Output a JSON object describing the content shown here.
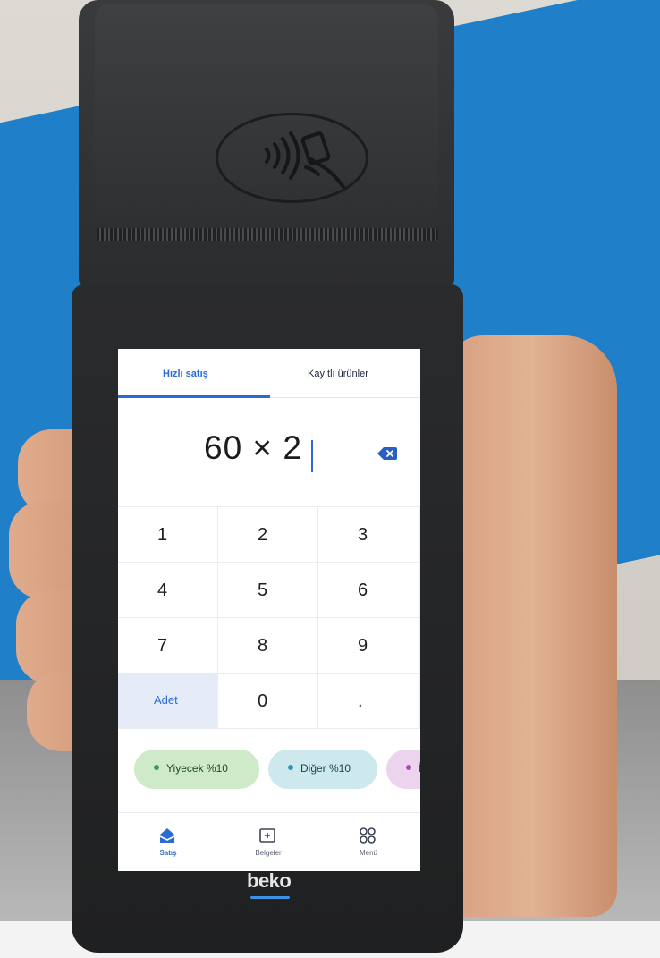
{
  "tabs": {
    "quick_sale": "Hızlı satış",
    "saved_products": "Kayıtlı ürünler"
  },
  "display": {
    "value": "60 × 2"
  },
  "keypad": {
    "keys": [
      "1",
      "2",
      "3",
      "4",
      "5",
      "6",
      "7",
      "8",
      "9",
      "Adet",
      "0",
      "."
    ]
  },
  "categories": [
    {
      "label": "Yiyecek %10",
      "color": "#cfeac9"
    },
    {
      "label": "Diğer %10",
      "color": "#cde9ee"
    },
    {
      "label": "İç",
      "color": "#ecd4ee"
    }
  ],
  "nav": {
    "sales": "Satış",
    "documents": "Belgeler",
    "menu": "Menü"
  },
  "device": {
    "brand": "beko"
  },
  "colors": {
    "accent": "#2a6bd6",
    "background_band": "#1f7fc9",
    "device_body": "#2a2b2d"
  },
  "icons": [
    "contactless-icon",
    "backspace-icon",
    "home-icon",
    "documents-icon",
    "menu-grid-icon"
  ]
}
